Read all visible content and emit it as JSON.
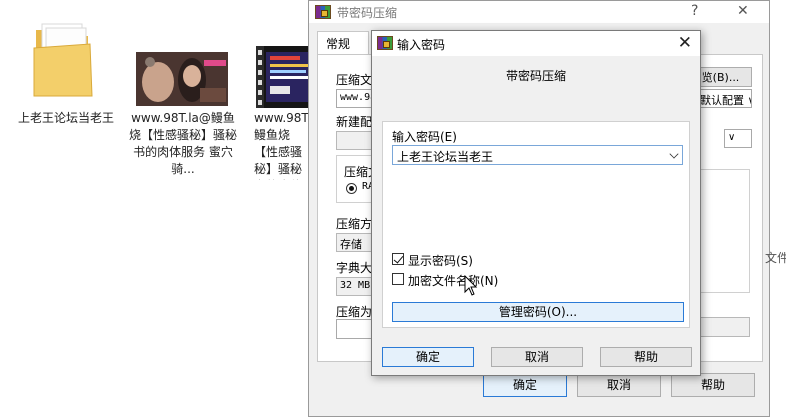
{
  "desktop": {
    "folder_label": "上老王论坛当老王",
    "file1_label": "www.98T.la@鳗鱼烧【性感骚秘】骚秘书的肉体服务 蜜穴骑...",
    "file2_label": "www.98T.la@鳗鱼烧【性感骚秘】骚秘书的肉体服务"
  },
  "back_window": {
    "title": "带密码压缩",
    "help_glyph": "?",
    "close_glyph": "✕",
    "tab_general": "常规",
    "archive_name_label": "压缩文件名",
    "browse_button": "浏览(B)...",
    "archive_name_value": "www.98T",
    "profile_value": "默认配置 ∨",
    "new_profile_label": "新建配置",
    "format_label": "压缩文件格式",
    "format_rar": "RAR",
    "method_label": "压缩方式",
    "method_value": "存储",
    "dict_label": "字典大小",
    "dict_value": "32 MB",
    "split_label": "压缩为分卷",
    "side_text": "文件",
    "ok_button": "确定",
    "cancel_button": "取消",
    "help_button": "帮助"
  },
  "dialog": {
    "title": "输入密码",
    "close_glyph": "✕",
    "header": "带密码压缩",
    "password_label": "输入密码(E)",
    "password_value": "上老王论坛当老王",
    "show_password_label": "显示密码(S)",
    "show_password_checked": true,
    "encrypt_names_label": "加密文件名称(N)",
    "encrypt_names_checked": false,
    "manage_button": "管理密码(O)...",
    "ok_button": "确定",
    "cancel_button": "取消",
    "help_button": "帮助"
  }
}
